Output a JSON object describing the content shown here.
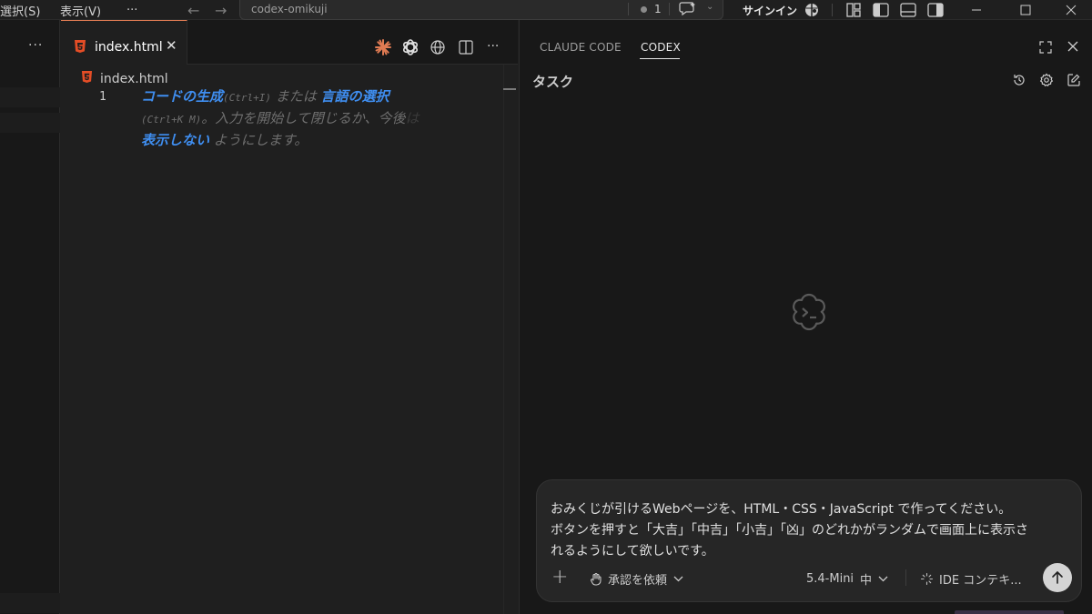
{
  "titlebar": {
    "menu_select": "選択(S)",
    "menu_view": "表示(V)",
    "menu_more": "···",
    "back_arrow": "←",
    "forward_arrow": "→",
    "command_center": "codex-omikuji",
    "notification_count": "1",
    "signin": "サインイン",
    "icons": [
      "copilot-icon",
      "layout-customize-icon",
      "toggle-primary-sidebar-icon",
      "toggle-panel-icon",
      "toggle-secondary-sidebar-icon"
    ],
    "window_controls": [
      "minimize",
      "maximize",
      "close"
    ]
  },
  "sidebar": {
    "more": "···"
  },
  "editor": {
    "tab": {
      "label": "index.html",
      "close": "✕",
      "icon": "html5-icon"
    },
    "tab_actions": [
      "claude-icon",
      "openai-icon",
      "globe-icon",
      "split-editor-icon",
      "more-actions-icon"
    ],
    "tab_more": "···",
    "breadcrumb": "index.html",
    "line_number": "1",
    "hint": {
      "link1": "コードの生成",
      "key1": "(Ctrl+I)",
      "text1": " または ",
      "link2": "言語の選択",
      "key2": "(Ctrl+K M)",
      "text2": "。入力を開始して閉じるか、今後",
      "fade": "は",
      "link3": "表示しない",
      "text3": " ようにします。"
    }
  },
  "panel": {
    "tabs": [
      {
        "label": "CLAUDE CODE",
        "active": false
      },
      {
        "label": "CODEX",
        "active": true
      }
    ],
    "header_icons": [
      "maximize-panel-icon",
      "close-panel-icon"
    ],
    "task_title": "タスク",
    "task_icons": [
      "history-icon",
      "settings-icon",
      "new-task-icon"
    ],
    "composer": {
      "prompt": "おみくじが引けるWebページを、HTML・CSS・JavaScript で作ってください。\nボタンを押すと「大吉」「中吉」「小吉」「凶」のどれかがランダムで画面上に表示さ\nれるようにして欲しいです。",
      "plus": "+",
      "approval": "承認を依頼",
      "model": "5.4-Mini",
      "reasoning": "中",
      "ide_context": "IDE コンテキ..."
    }
  },
  "colors": {
    "background": "#1f1f1f",
    "panel_background": "#181818",
    "link_blue": "#3f8ef0",
    "html_orange": "#e44d26",
    "tab_accent": "#e07b53"
  }
}
